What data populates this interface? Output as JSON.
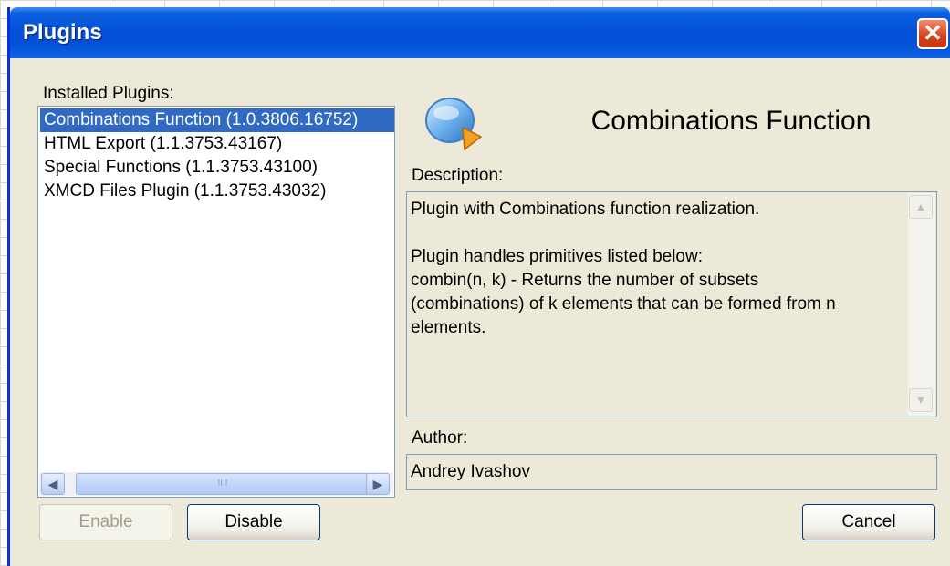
{
  "window": {
    "title": "Plugins",
    "close_label": "✕"
  },
  "installed": {
    "label": "Installed Plugins:",
    "items": [
      {
        "label": "Combinations Function (1.0.3806.16752)",
        "selected": true
      },
      {
        "label": "HTML Export (1.1.3753.43167)",
        "selected": false
      },
      {
        "label": "Special Functions (1.1.3753.43100)",
        "selected": false
      },
      {
        "label": "XMCD Files Plugin (1.1.3753.43032)",
        "selected": false
      }
    ],
    "scroll_left": "◀",
    "scroll_right": "▶",
    "scroll_grip": "IIII"
  },
  "details": {
    "icon": "plugin-disk-icon",
    "title": "Combinations Function",
    "description_label": "Description:",
    "description": "Plugin with Combinations function realization.\n\nPlugin handles primitives listed below:\ncombin(n, k) - Returns the number of subsets\n(combinations) of k elements that can be formed from n\nelements.",
    "scroll_up": "▲",
    "scroll_down": "▼",
    "author_label": "Author:",
    "author": "Andrey Ivashov"
  },
  "buttons": {
    "enable": "Enable",
    "disable": "Disable",
    "cancel": "Cancel"
  },
  "colors": {
    "selection": "#316ac5",
    "dialog_bg": "#ece9d8",
    "titlebar": "#0551d8"
  }
}
